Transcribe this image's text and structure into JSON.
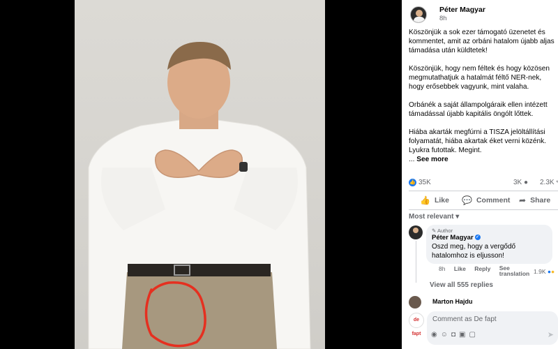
{
  "post": {
    "author": "Péter Magyar",
    "time": "8h",
    "paragraphs": [
      "Köszönjük a sok ezer támogató üzenetet és kommentet, amit az orbáni hatalom újabb aljas támadása után küldtetek!",
      "Köszönjük, hogy nem féltek és hogy közösen megmutathatjuk a hatalmát féltő NER-nek, hogy erősebbek vagyunk, mint valaha.",
      "Orbánék a saját állampolgáraik ellen intézett támadással újabb kapitális öngólt lőttek.",
      "Hiába akarták megfúrni a TISZA jelöltállítási folyamatát, hiába akartak éket verni közénk. Lyukra futottak. Megint."
    ],
    "see_more_prefix": "... ",
    "see_more": "See more"
  },
  "stats": {
    "reactions": "35K",
    "comments": "3K",
    "shares": "2.3K"
  },
  "actions": {
    "like": "Like",
    "comment": "Comment",
    "share": "Share"
  },
  "filter": {
    "label": "Most relevant"
  },
  "comment": {
    "badge": "Author",
    "author": "Péter Magyar",
    "text": "Oszd meg, hogy a vergődő hatalomhoz is eljusson!",
    "time": "8h",
    "like": "Like",
    "reply": "Reply",
    "see_translation": "See translation",
    "reactions": "1.9K"
  },
  "view_replies": "View all 555 replies",
  "second_comment_author": "Marton Hajdu",
  "composer": {
    "placeholder": "Comment as De fapt",
    "avatar_text": "de fapt"
  },
  "colors": {
    "accent": "#1877f2",
    "annotation": "#e53020"
  }
}
